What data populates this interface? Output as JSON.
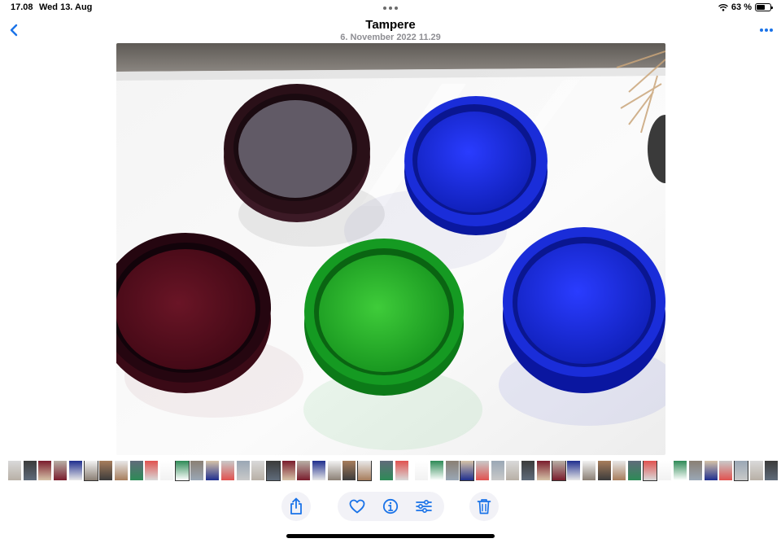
{
  "status_bar": {
    "time": "17.08",
    "date": "Wed 13. Aug",
    "battery": "63 %",
    "battery_level": 0.63
  },
  "header": {
    "title": "Tampere",
    "subtitle": "6. November 2022  11.29"
  },
  "icons": {
    "back": "chevron-left-icon",
    "more": "ellipsis-circle-icon",
    "share": "share-icon",
    "favorite": "heart-icon",
    "info": "info-icon",
    "adjust": "sliders-icon",
    "delete": "trash-icon",
    "wifi": "wifi-icon",
    "battery": "battery-icon"
  },
  "colors": {
    "accent": "#1a73e8"
  }
}
